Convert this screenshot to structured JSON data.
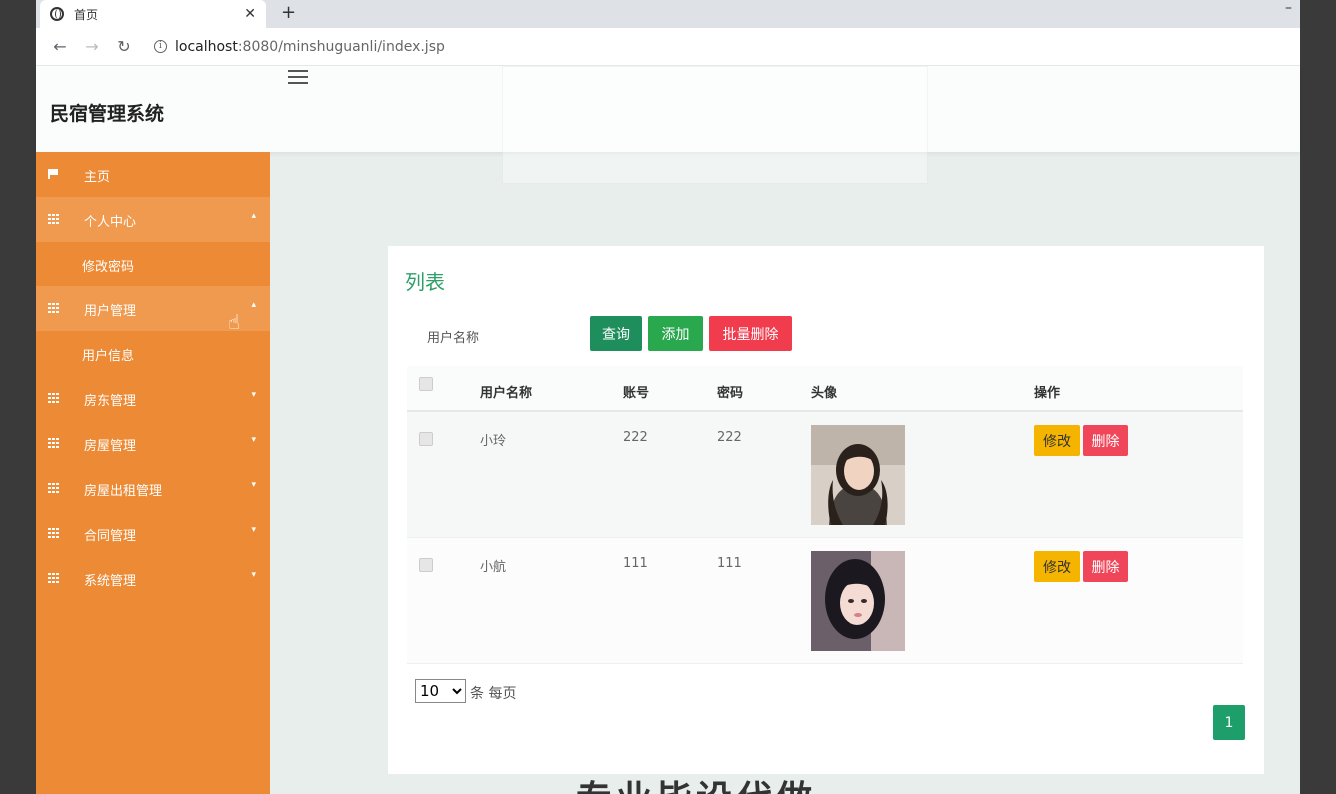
{
  "browser": {
    "tab_title": "首页",
    "tab_close": "✕",
    "new_tab": "+",
    "url_host": "localhost",
    "url_rest": ":8080/minshuguanli/index.jsp"
  },
  "header": {
    "brand": "民宿管理系统"
  },
  "sidebar": {
    "items": [
      {
        "label": "主页"
      },
      {
        "label": "个人中心"
      },
      {
        "label": "修改密码"
      },
      {
        "label": "用户管理"
      },
      {
        "label": "用户信息"
      },
      {
        "label": "房东管理"
      },
      {
        "label": "房屋管理"
      },
      {
        "label": "房屋出租管理"
      },
      {
        "label": "合同管理"
      },
      {
        "label": "系统管理"
      }
    ]
  },
  "main": {
    "title": "列表",
    "search_label": "用户名称",
    "btn_search": "查询",
    "btn_add": "添加",
    "btn_batch_delete": "批量删除",
    "columns": [
      "用户名称",
      "账号",
      "密码",
      "头像",
      "操作"
    ],
    "rows": [
      {
        "name": "小玲",
        "account": "222",
        "password": "222"
      },
      {
        "name": "小航",
        "account": "111",
        "password": "111"
      }
    ],
    "btn_edit": "修改",
    "btn_delete": "删除",
    "page_size": "10",
    "page_size_label": "条 每页",
    "current_page": "1"
  },
  "banner_text": "专业毕设代做",
  "colors": {
    "sidebar": "#ec8a35",
    "title_green": "#2e9f68",
    "search_btn": "#1e8e5c",
    "add_btn": "#2aa84e",
    "danger": "#f03c4c",
    "warning": "#f4b400"
  }
}
